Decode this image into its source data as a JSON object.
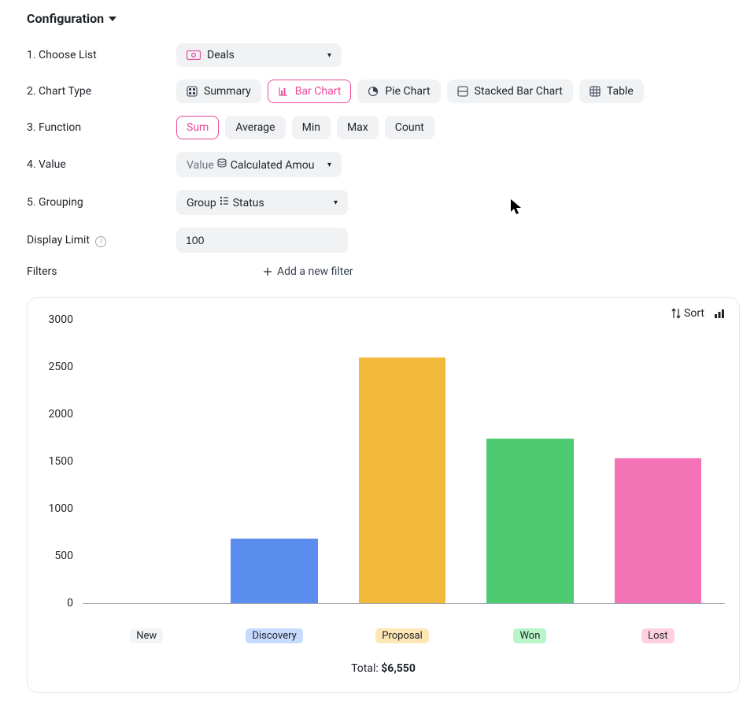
{
  "config": {
    "header": "Configuration",
    "rows": {
      "choose_list": {
        "num": "1.",
        "label": "Choose List"
      },
      "chart_type": {
        "num": "2.",
        "label": "Chart Type"
      },
      "function": {
        "num": "3.",
        "label": "Function"
      },
      "value": {
        "num": "4.",
        "label": "Value"
      },
      "grouping": {
        "num": "5.",
        "label": "Grouping"
      },
      "display_limit": {
        "label": "Display Limit"
      },
      "filters": {
        "label": "Filters"
      }
    },
    "list_select": {
      "value": "Deals"
    },
    "chart_types": {
      "summary": "Summary",
      "bar": "Bar Chart",
      "pie": "Pie Chart",
      "stacked": "Stacked Bar Chart",
      "table": "Table"
    },
    "functions": {
      "sum": "Sum",
      "avg": "Average",
      "min": "Min",
      "max": "Max",
      "count": "Count"
    },
    "value_select": {
      "key": "Value",
      "value": "Calculated Amou"
    },
    "group_select": {
      "key": "Group",
      "value": "Status"
    },
    "display_limit_value": "100",
    "add_filter": "Add a new filter"
  },
  "chart_actions": {
    "sort": "Sort"
  },
  "chart_total": {
    "label": "Total:",
    "amount": "$6,550"
  },
  "chart_data": {
    "type": "bar",
    "categories": [
      "New",
      "Discovery",
      "Proposal",
      "Won",
      "Lost"
    ],
    "values": [
      0,
      680,
      2600,
      1740,
      1530
    ],
    "colors": [
      "#e5e7eb",
      "#5b8def",
      "#f2b93b",
      "#4ecb71",
      "#f472b6"
    ],
    "badge_bg": [
      "#f3f4f6",
      "#c7dbff",
      "#fde7b4",
      "#b9f5c9",
      "#ffd1df"
    ],
    "yticks": [
      0,
      500,
      1000,
      1500,
      2000,
      2500,
      3000
    ],
    "ylim": [
      0,
      3000
    ],
    "total": 6550,
    "xlabel": "",
    "ylabel": ""
  }
}
